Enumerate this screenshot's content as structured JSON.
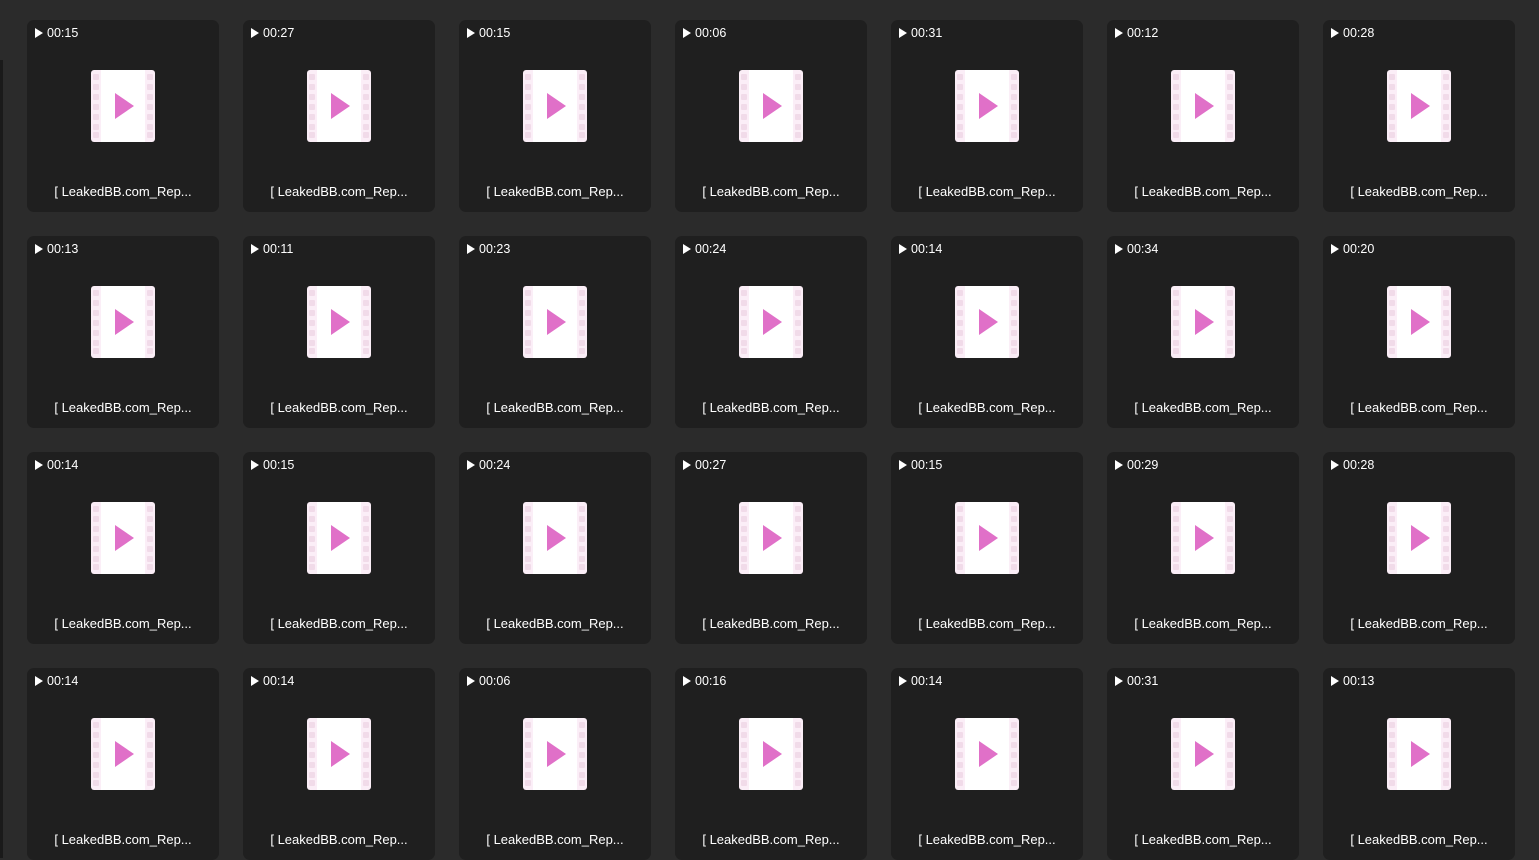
{
  "icon": {
    "tile_icon": "video-file-icon",
    "duration_icon": "play-icon",
    "accent_color": "#e070c8",
    "film_color": "#fbeef7"
  },
  "tiles": [
    {
      "duration": "00:15",
      "name": "[ LeakedBB.com_Rep..."
    },
    {
      "duration": "00:27",
      "name": "[ LeakedBB.com_Rep..."
    },
    {
      "duration": "00:15",
      "name": "[ LeakedBB.com_Rep..."
    },
    {
      "duration": "00:06",
      "name": "[ LeakedBB.com_Rep..."
    },
    {
      "duration": "00:31",
      "name": "[ LeakedBB.com_Rep..."
    },
    {
      "duration": "00:12",
      "name": "[ LeakedBB.com_Rep..."
    },
    {
      "duration": "00:28",
      "name": "[ LeakedBB.com_Rep..."
    },
    {
      "duration": "00:13",
      "name": "[ LeakedBB.com_Rep..."
    },
    {
      "duration": "00:11",
      "name": "[ LeakedBB.com_Rep..."
    },
    {
      "duration": "00:23",
      "name": "[ LeakedBB.com_Rep..."
    },
    {
      "duration": "00:24",
      "name": "[ LeakedBB.com_Rep..."
    },
    {
      "duration": "00:14",
      "name": "[ LeakedBB.com_Rep..."
    },
    {
      "duration": "00:34",
      "name": "[ LeakedBB.com_Rep..."
    },
    {
      "duration": "00:20",
      "name": "[ LeakedBB.com_Rep..."
    },
    {
      "duration": "00:14",
      "name": "[ LeakedBB.com_Rep..."
    },
    {
      "duration": "00:15",
      "name": "[ LeakedBB.com_Rep..."
    },
    {
      "duration": "00:24",
      "name": "[ LeakedBB.com_Rep..."
    },
    {
      "duration": "00:27",
      "name": "[ LeakedBB.com_Rep..."
    },
    {
      "duration": "00:15",
      "name": "[ LeakedBB.com_Rep..."
    },
    {
      "duration": "00:29",
      "name": "[ LeakedBB.com_Rep..."
    },
    {
      "duration": "00:28",
      "name": "[ LeakedBB.com_Rep..."
    },
    {
      "duration": "00:14",
      "name": "[ LeakedBB.com_Rep..."
    },
    {
      "duration": "00:14",
      "name": "[ LeakedBB.com_Rep..."
    },
    {
      "duration": "00:06",
      "name": "[ LeakedBB.com_Rep..."
    },
    {
      "duration": "00:16",
      "name": "[ LeakedBB.com_Rep..."
    },
    {
      "duration": "00:14",
      "name": "[ LeakedBB.com_Rep..."
    },
    {
      "duration": "00:31",
      "name": "[ LeakedBB.com_Rep..."
    },
    {
      "duration": "00:13",
      "name": "[ LeakedBB.com_Rep..."
    }
  ]
}
